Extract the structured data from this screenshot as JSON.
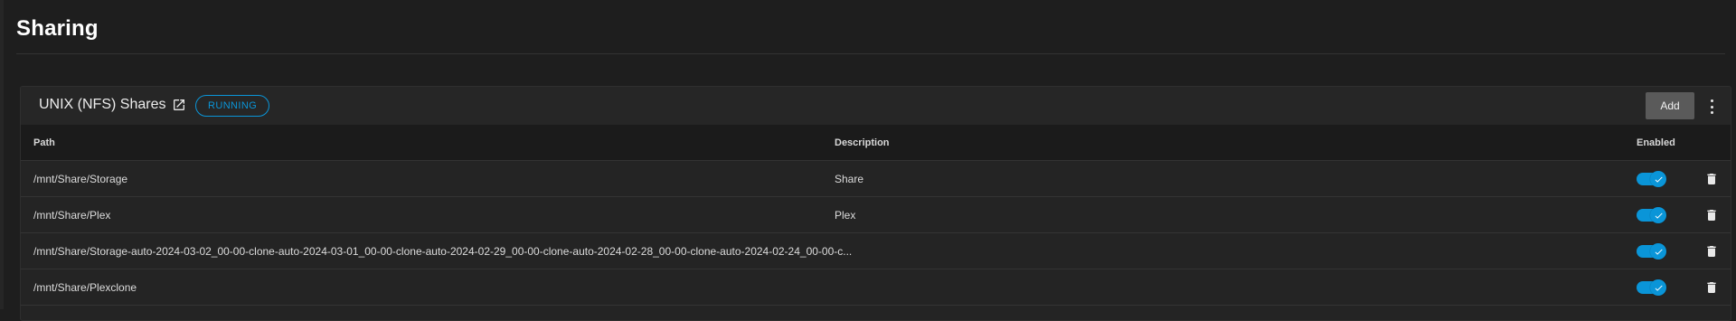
{
  "page": {
    "title": "Sharing"
  },
  "card": {
    "title": "UNIX (NFS) Shares",
    "title_icon": "open-in-new-icon",
    "status": "RUNNING",
    "add_label": "Add",
    "more_icon": "more-vert-icon"
  },
  "table": {
    "headers": {
      "path": "Path",
      "description": "Description",
      "enabled": "Enabled"
    },
    "rows": [
      {
        "path": "/mnt/Share/Storage",
        "description": "Share",
        "enabled": true
      },
      {
        "path": "/mnt/Share/Plex",
        "description": "Plex",
        "enabled": true
      },
      {
        "path": "/mnt/Share/Storage-auto-2024-03-02_00-00-clone-auto-2024-03-01_00-00-clone-auto-2024-02-29_00-00-clone-auto-2024-02-28_00-00-clone-auto-2024-02-24_00-00-c...",
        "description": "",
        "enabled": true
      },
      {
        "path": "/mnt/Share/Plexclone",
        "description": "",
        "enabled": true
      }
    ]
  },
  "colors": {
    "accent": "#0a95d8",
    "background": "#1e1e1e",
    "card": "#242424",
    "add_button": "#5a5a5a"
  }
}
